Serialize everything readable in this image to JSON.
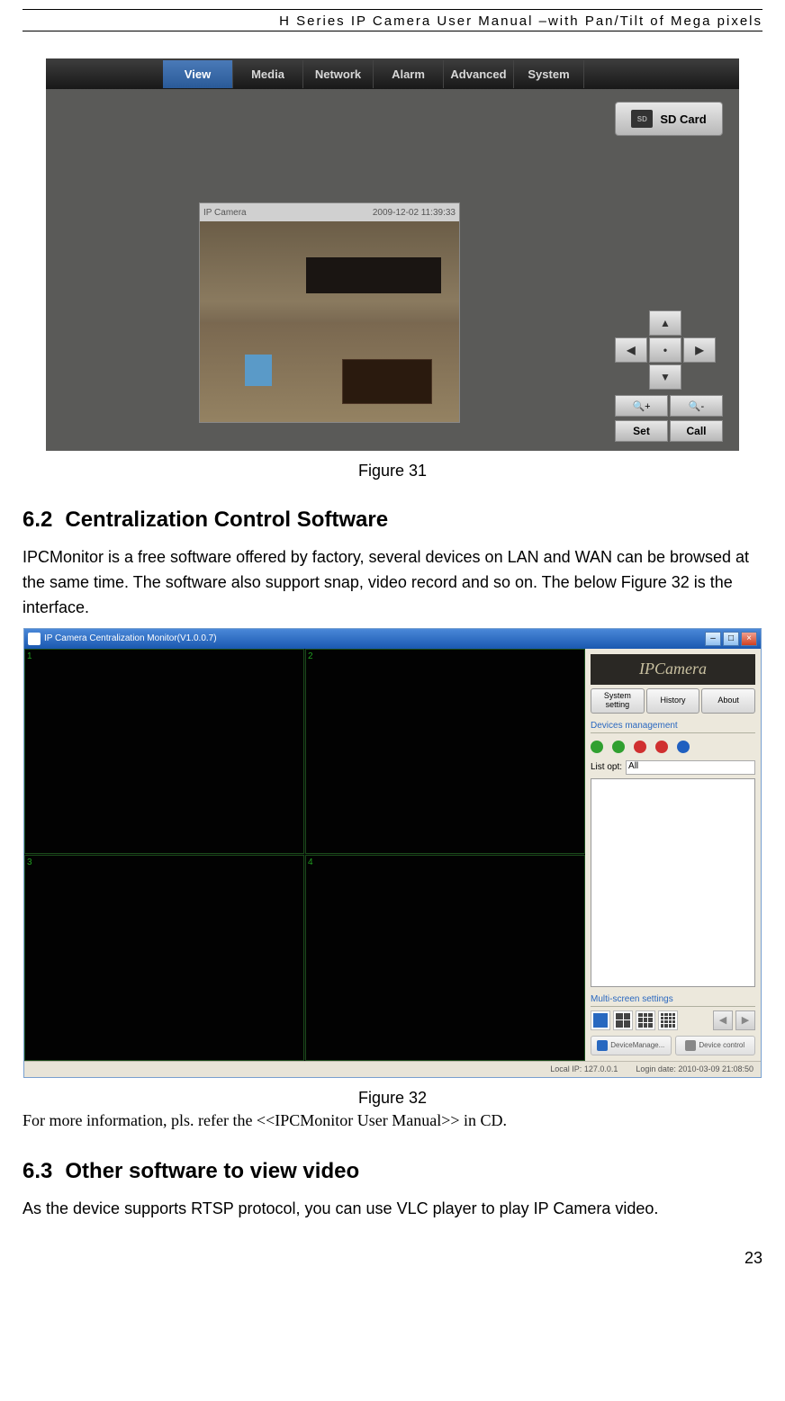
{
  "page_header": "H Series IP Camera User Manual –with Pan/Tilt of Mega pixels",
  "page_number": "23",
  "figure31": {
    "caption": "Figure 31",
    "nav": [
      "View",
      "Media",
      "Network",
      "Alarm",
      "Advanced",
      "System"
    ],
    "sd_card": "SD Card",
    "video_title": "IP Camera",
    "video_timestamp": "2009-12-02 11:39:33",
    "ptz": {
      "up": "▲",
      "down": "▼",
      "left": "◀",
      "right": "▶",
      "center": "•"
    },
    "set": "Set",
    "call": "Call"
  },
  "section62": {
    "num": "6.2",
    "title": "Centralization Control Software",
    "body": "IPCMonitor is a free software offered by factory, several devices on LAN and WAN can be browsed at the same time. The software also support snap, video record and so on. The below Figure 32 is the interface."
  },
  "figure32": {
    "caption": "Figure 32",
    "title": "IP Camera Centralization Monitor(V1.0.0.7)",
    "logo": "IPCamera",
    "top_buttons": [
      "System setting",
      "History",
      "About"
    ],
    "devices_label": "Devices management",
    "listopt_label": "List opt:",
    "listopt_value": "All",
    "multiscreen_label": "Multi-screen settings",
    "cells": [
      "1",
      "2",
      "3",
      "4"
    ],
    "bottom_buttons": [
      "DeviceManage...",
      "Device control"
    ],
    "status_ip_label": "Local IP:",
    "status_ip_value": "127.0.0.1",
    "status_date_label": "Login date:",
    "status_date_value": "2010-03-09 21:08:50",
    "info_line": "For more information, pls. refer the <<IPCMonitor User Manual>> in CD.",
    "dev_icon_colors": [
      "#30a030",
      "#30a030",
      "#d03030",
      "#d03030",
      "#2060c0"
    ]
  },
  "section63": {
    "num": "6.3",
    "title": "Other software to view video",
    "body": "As the device supports RTSP protocol, you can use VLC player to play IP Camera video."
  }
}
